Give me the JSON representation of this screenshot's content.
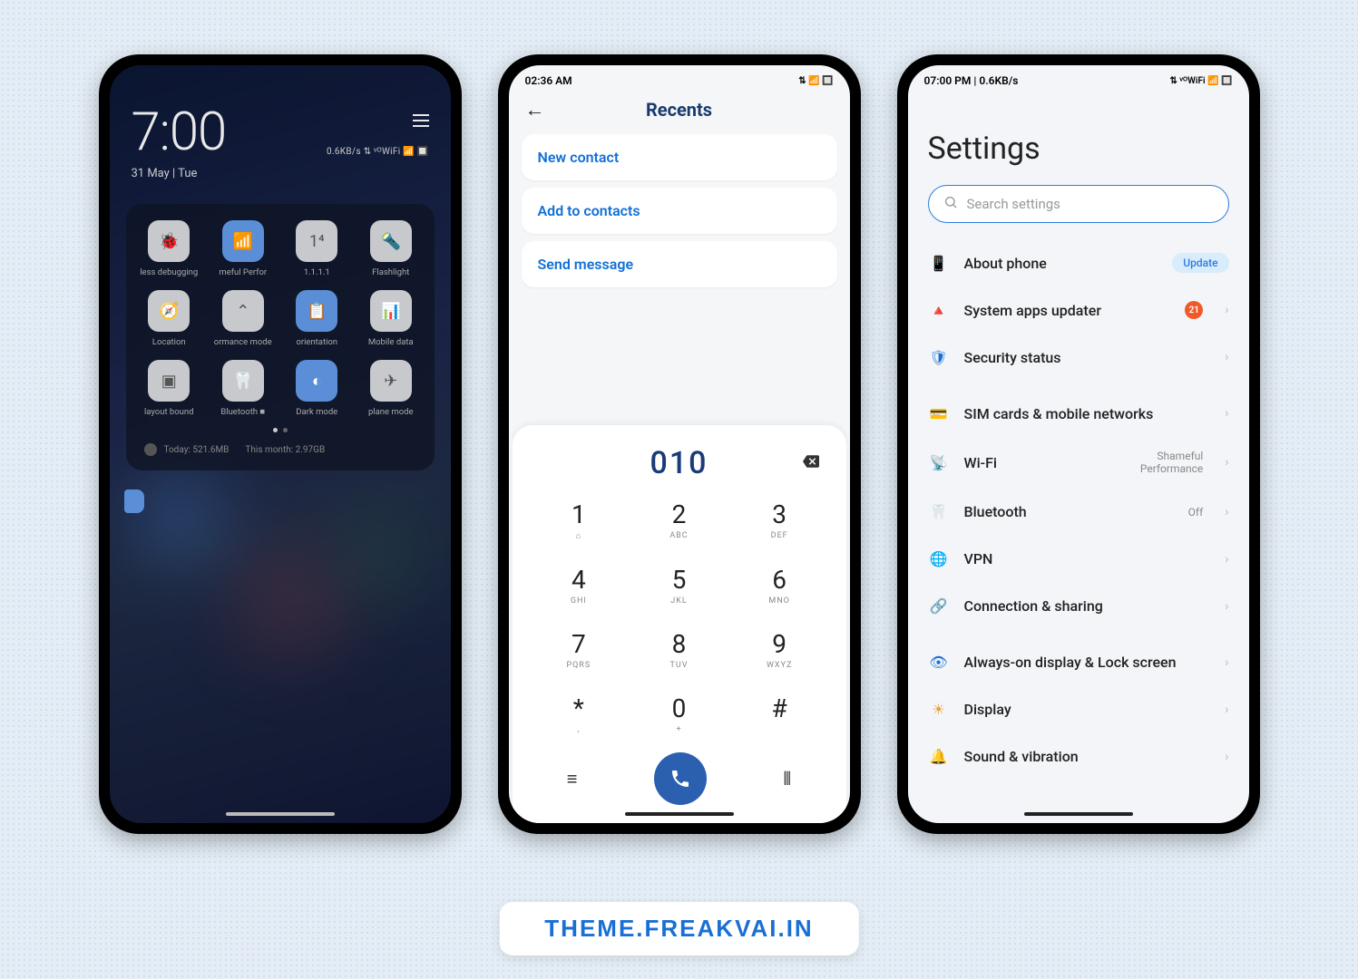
{
  "watermark": "THEME.FREAKVAI.IN",
  "phone1": {
    "clock": "7:00",
    "date": "31 May | Tue",
    "status": "0.6KB/s ⇅ ᵛᴼWiFi 📶 🔲",
    "tiles": [
      {
        "label": "less debugging",
        "active": false,
        "icon": "🐞"
      },
      {
        "label": "meful Perfor",
        "active": true,
        "icon": "📶"
      },
      {
        "label": "1.1.1.1",
        "active": false,
        "icon": "1⁴"
      },
      {
        "label": "Flashlight",
        "active": false,
        "icon": "🔦"
      },
      {
        "label": "Location",
        "active": false,
        "icon": "🧭"
      },
      {
        "label": "ormance mode",
        "active": false,
        "icon": "⌃"
      },
      {
        "label": "orientation",
        "active": true,
        "icon": "📋"
      },
      {
        "label": "Mobile data",
        "active": false,
        "icon": "📊"
      },
      {
        "label": "layout bound",
        "active": false,
        "icon": "▣"
      },
      {
        "label": "Bluetooth ■",
        "active": false,
        "icon": "🦷"
      },
      {
        "label": "Dark mode",
        "active": true,
        "icon": "◐"
      },
      {
        "label": "plane mode",
        "active": false,
        "icon": "✈"
      }
    ],
    "usage_today": "Today: 521.6MB",
    "usage_month": "This month: 2.97GB"
  },
  "phone2": {
    "status_time": "02:36 AM",
    "status_icons": "⇅ 📶 🔲",
    "title": "Recents",
    "actions": [
      {
        "label": "New contact"
      },
      {
        "label": "Add to contacts"
      },
      {
        "label": "Send message"
      }
    ],
    "dialed": "010",
    "keys": [
      {
        "n": "1",
        "l": "⌂"
      },
      {
        "n": "2",
        "l": "ABC"
      },
      {
        "n": "3",
        "l": "DEF"
      },
      {
        "n": "4",
        "l": "GHI"
      },
      {
        "n": "5",
        "l": "JKL"
      },
      {
        "n": "6",
        "l": "MNO"
      },
      {
        "n": "7",
        "l": "PQRS"
      },
      {
        "n": "8",
        "l": "TUV"
      },
      {
        "n": "9",
        "l": "WXYZ"
      },
      {
        "n": "*",
        "l": ","
      },
      {
        "n": "0",
        "l": "+"
      },
      {
        "n": "#",
        "l": ""
      }
    ]
  },
  "phone3": {
    "status_time": "07:00 PM | 0.6KB/s",
    "status_icons": "⇅ ᵛᴼWiFi 📶 🔲",
    "title": "Settings",
    "search_placeholder": "Search settings",
    "rows": [
      {
        "icon": "📱",
        "color": "#1a3a6e",
        "label": "About phone",
        "badge": "Update",
        "arrow": false
      },
      {
        "icon": "🔺",
        "color": "#1a6fd4",
        "label": "System apps updater",
        "count": "21",
        "arrow": true
      },
      {
        "icon": "🛡",
        "color": "#1a6fd4",
        "label": "Security status",
        "arrow": true
      },
      {
        "gap": true
      },
      {
        "icon": "💳",
        "color": "#e8a030",
        "label": "SIM cards & mobile networks",
        "arrow": true
      },
      {
        "icon": "📡",
        "color": "#1a6fd4",
        "label": "Wi-Fi",
        "value": "Shameful\nPerformance",
        "arrow": true
      },
      {
        "icon": "🦷",
        "color": "#4a8fd0",
        "label": "Bluetooth",
        "value": "Off",
        "arrow": true
      },
      {
        "icon": "🌐",
        "color": "#1a6fd4",
        "label": "VPN",
        "arrow": true
      },
      {
        "icon": "🔗",
        "color": "#2a8a6a",
        "label": "Connection & sharing",
        "arrow": true
      },
      {
        "gap": true
      },
      {
        "icon": "👁",
        "color": "#1a6fd4",
        "label": "Always-on display & Lock screen",
        "arrow": true
      },
      {
        "icon": "☀",
        "color": "#e8a030",
        "label": "Display",
        "arrow": true
      },
      {
        "icon": "🔔",
        "color": "#222",
        "label": "Sound & vibration",
        "arrow": true
      }
    ]
  }
}
